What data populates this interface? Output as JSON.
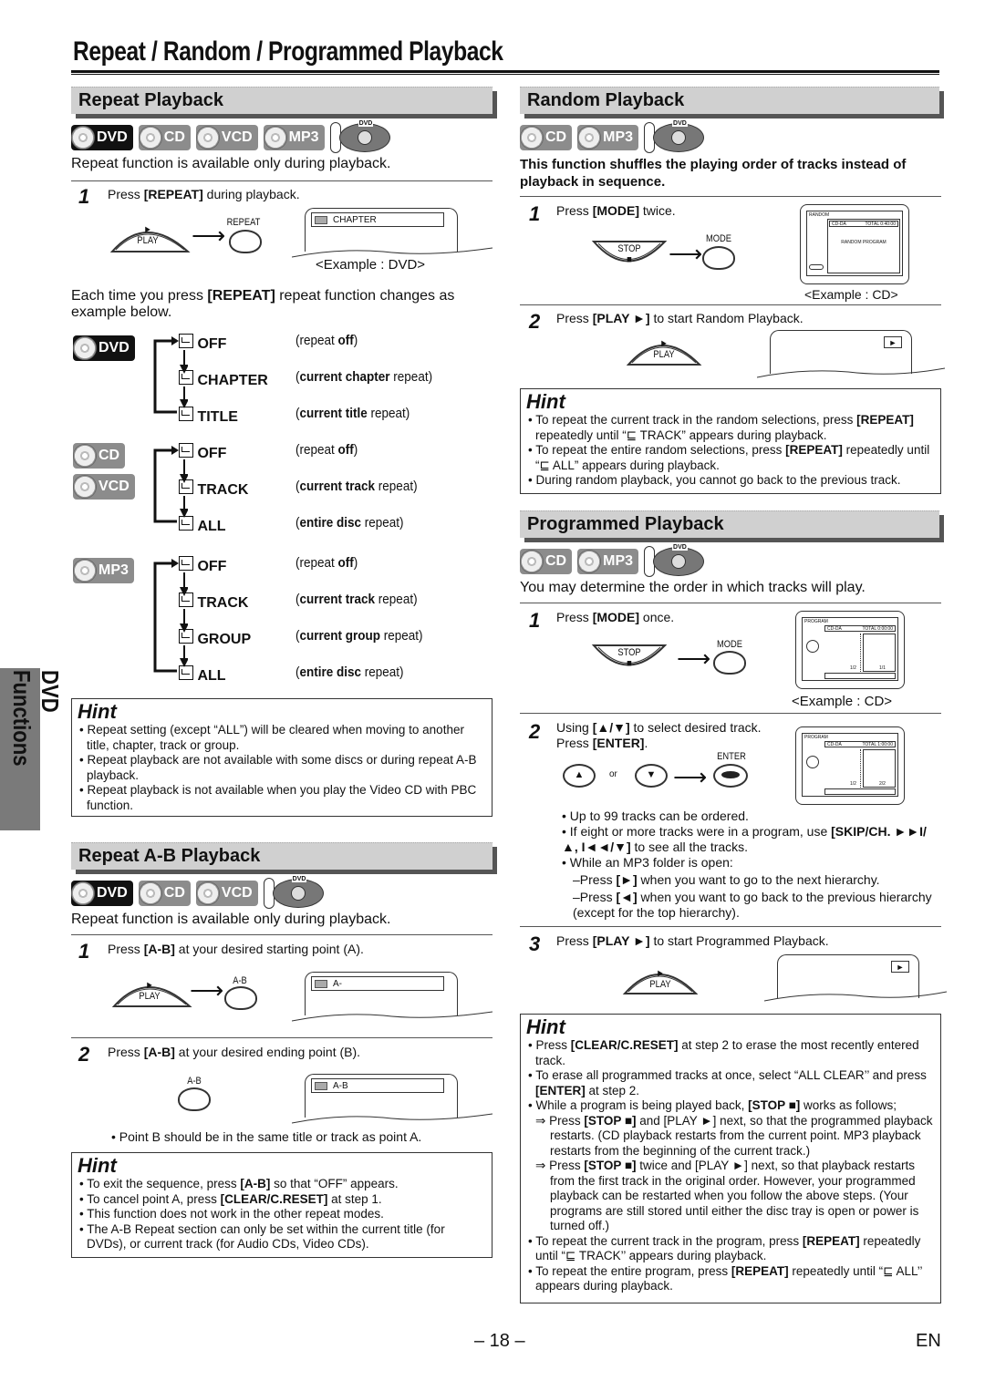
{
  "page": {
    "title": "Repeat / Random / Programmed Playback",
    "side_tab": "DVD Functions",
    "page_number": "– 18 –",
    "language": "EN"
  },
  "icons": {
    "disc": "disc-icon",
    "remote": "remote-control-icon",
    "repeat": "repeat-icon",
    "arrow": "arrow-right-icon"
  },
  "badges": {
    "dvd": "DVD",
    "cd": "CD",
    "vcd": "VCD",
    "mp3": "MP3",
    "remote": "DVD"
  },
  "repeat": {
    "heading": "Repeat Playback",
    "intro": "Repeat function is available only during playback.",
    "step1": {
      "num": "1",
      "pre": "Press ",
      "key": "[REPEAT]",
      "post": " during playback.",
      "play_label": "PLAY",
      "play_symbol": "►",
      "button_label": "REPEAT",
      "osd_text": "CHAPTER",
      "caption": "<Example : DVD>"
    },
    "each_time": {
      "pre": "Each time you press ",
      "key": "[REPEAT]",
      "post": " repeat function changes as example below."
    },
    "groups": [
      {
        "badges": [
          "DVD"
        ],
        "items": [
          {
            "label": "OFF",
            "desc_pre": "(repeat ",
            "desc_bold": "off",
            "desc_post": ")"
          },
          {
            "label": "CHAPTER",
            "desc_pre": "(",
            "desc_bold": "current chapter",
            "desc_post": " repeat)"
          },
          {
            "label": "TITLE",
            "desc_pre": "(",
            "desc_bold": "current title",
            "desc_post": " repeat)"
          }
        ]
      },
      {
        "badges": [
          "CD",
          "VCD"
        ],
        "items": [
          {
            "label": "OFF",
            "desc_pre": "(repeat ",
            "desc_bold": "off",
            "desc_post": ")"
          },
          {
            "label": "TRACK",
            "desc_pre": "(",
            "desc_bold": "current track",
            "desc_post": " repeat)"
          },
          {
            "label": "ALL",
            "desc_pre": "(",
            "desc_bold": "entire disc",
            "desc_post": " repeat)"
          }
        ]
      },
      {
        "badges": [
          "MP3"
        ],
        "items": [
          {
            "label": "OFF",
            "desc_pre": "(repeat ",
            "desc_bold": "off",
            "desc_post": ")"
          },
          {
            "label": "TRACK",
            "desc_pre": "(",
            "desc_bold": "current track",
            "desc_post": " repeat)"
          },
          {
            "label": "GROUP",
            "desc_pre": "(",
            "desc_bold": "current group",
            "desc_post": " repeat)"
          },
          {
            "label": "ALL",
            "desc_pre": "(",
            "desc_bold": "entire disc",
            "desc_post": " repeat)"
          }
        ]
      }
    ],
    "hint": {
      "title": "Hint",
      "items": [
        "Repeat setting (except “ALL”) will be cleared when moving to another title, chapter, track or group.",
        "Repeat playback are not available with some discs or during repeat A-B playback.",
        "Repeat playback is not available when you play the Video CD with PBC function."
      ]
    }
  },
  "ab": {
    "heading": "Repeat A-B Playback",
    "intro": "Repeat function is available only during playback.",
    "step1": {
      "num": "1",
      "pre": "Press ",
      "key": "[A-B]",
      "post": " at your desired starting point (A).",
      "play_label": "PLAY",
      "play_symbol": "►",
      "button_label": "A-B",
      "osd_text": "A-"
    },
    "step2": {
      "num": "2",
      "pre": "Press ",
      "key": "[A-B]",
      "post": " at your desired ending point (B).",
      "button_label": "A-B",
      "osd_text": "A-B",
      "note": "Point B should be in the same title or track as point A."
    },
    "hint": {
      "title": "Hint",
      "items": [
        {
          "pre": "To exit the sequence, press ",
          "key": "[A-B]",
          "post": " so that “OFF” appears."
        },
        {
          "pre": "To cancel point A, press ",
          "key": "[CLEAR/C.RESET]",
          "post": " at step 1."
        },
        {
          "pre": "This function does not work in the other repeat modes.",
          "key": "",
          "post": ""
        },
        {
          "pre": "The A-B Repeat section can only be set within the current title (for DVDs), or current track (for Audio CDs, Video CDs).",
          "key": "",
          "post": ""
        }
      ]
    }
  },
  "random": {
    "heading": "Random Playback",
    "intro": "This function shuffles the playing order of tracks instead of playback in sequence.",
    "step1": {
      "num": "1",
      "pre": "Press ",
      "key": "[MODE]",
      "post": " twice.",
      "stop_label": "STOP",
      "stop_symbol": "■",
      "button_label": "MODE",
      "caption": "<Example : CD>",
      "tv": {
        "mode": "RANDOM",
        "disc": "CD-DA",
        "total": "TOTAL 0:40:00",
        "center": "RANDOM PROGRAM"
      }
    },
    "step2": {
      "num": "2",
      "pre": "Press ",
      "key": "[PLAY ►]",
      "post": " to start Random Playback.",
      "play_label": "PLAY",
      "play_symbol": "►",
      "osd_symbol": "►"
    },
    "hint": {
      "title": "Hint",
      "items": [
        {
          "pre": "To repeat the current track in the random selections, press ",
          "key": "[REPEAT]",
          "post": " repeatedly until “⊑ TRACK” appears during playback."
        },
        {
          "pre": "To repeat the entire random selections, press ",
          "key": "[REPEAT]",
          "post": " repeatedly until “⊑ ALL” appears during playback."
        },
        {
          "pre": "During random playback, you cannot go back to the previous track.",
          "key": "",
          "post": ""
        }
      ]
    }
  },
  "program": {
    "heading": "Programmed Playback",
    "intro": "You may determine the order in which tracks will play.",
    "step1": {
      "num": "1",
      "pre": "Press ",
      "key": "[MODE]",
      "post": " once.",
      "stop_label": "STOP",
      "stop_symbol": "■",
      "button_label": "MODE",
      "caption": "<Example : CD>",
      "tv": {
        "mode": "PROGRAM",
        "disc": "CD-DA",
        "total": "TOTAL 0:00:00",
        "page_left": "1/2",
        "page_right": "1/1"
      }
    },
    "step2": {
      "num": "2",
      "line1_pre": "Using ",
      "line1_key": "[▲/▼]",
      "line1_post": " to select desired track.",
      "line2_pre": "Press ",
      "line2_key": "[ENTER]",
      "line2_post": ".",
      "up_symbol": "▲",
      "or": "or",
      "down_symbol": "▼",
      "button_label": "ENTER",
      "tv": {
        "mode": "PROGRAM",
        "disc": "CD-DA",
        "total": "TOTAL 1:00:00",
        "page_left": "1/2",
        "page_right": "2/2"
      },
      "bullets": [
        {
          "pre": "Up to 99 tracks can be ordered.",
          "key": "",
          "post": ""
        },
        {
          "pre": "If eight or more tracks were in a program, use ",
          "key": "[SKIP/CH. ►►I/▲, I◄◄/▼]",
          "post": " to see all the tracks."
        },
        {
          "pre": "While an MP3 folder is open:",
          "key": "",
          "post": ""
        }
      ],
      "dashes": [
        {
          "pre": "–Press ",
          "key": "[►]",
          "post": " when you want to go to the next hierarchy."
        },
        {
          "pre": "–Press ",
          "key": "[◄]",
          "post": " when you want to go back to the previous hierarchy (except for the top hierarchy)."
        }
      ]
    },
    "step3": {
      "num": "3",
      "pre": "Press ",
      "key": "[PLAY ►]",
      "post": " to start Programmed Playback.",
      "play_label": "PLAY",
      "play_symbol": "►",
      "osd_symbol": "►"
    },
    "hint": {
      "title": "Hint",
      "items": [
        {
          "type": "bullet",
          "pre": "Press ",
          "key": "[CLEAR/C.RESET]",
          "post": " at step 2 to erase the most recently entered track."
        },
        {
          "type": "bullet",
          "pre": "To erase all programmed tracks at once, select “ALL CLEAR’’ and press ",
          "key": "[ENTER]",
          "post": " at step 2."
        },
        {
          "type": "bullet",
          "pre": "While a program is being played back, ",
          "key": "[STOP ■]",
          "post": " works as follows;"
        },
        {
          "type": "sub",
          "pre": "Press ",
          "key": "[STOP ■]",
          "post": " and [PLAY ►] next, so that the programmed playback restarts. (CD playback restarts from the current point. MP3 playback restarts from the beginning of the current track.)"
        },
        {
          "type": "sub",
          "pre": "Press ",
          "key": "[STOP ■]",
          "post": " twice and [PLAY ►] next, so that playback restarts from the first track in the original order. However, your programmed playback can be restarted when you follow the above steps. (Your programs are still stored until either the disc tray is open or power is turned off.)"
        },
        {
          "type": "bullet",
          "pre": "To repeat the current track in the program, press ",
          "key": "[REPEAT]",
          "post": " repeatedly until “⊑ TRACK’’ appears during playback."
        },
        {
          "type": "bullet",
          "pre": "To repeat the entire program, press ",
          "key": "[REPEAT]",
          "post": " repeatedly until “⊑ ALL’’ appears during playback."
        }
      ]
    }
  }
}
